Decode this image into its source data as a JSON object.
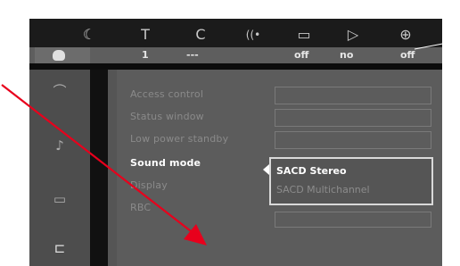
{
  "header": {
    "icons": [
      "settings-icon",
      "text-icon",
      "subtitle-c-icon",
      "audio-wave-icon",
      "screen-icon",
      "play-icon",
      "zoom-in-icon"
    ],
    "glyphs": [
      "☾",
      "T",
      "C",
      "((•",
      "▭",
      "▷",
      "⊕"
    ]
  },
  "value_bar": {
    "values": [
      "1",
      "---",
      "off",
      "no",
      "off"
    ]
  },
  "sidebar": {
    "icons": [
      "gauge-icon",
      "music-note-icon",
      "speech-bubble-icon",
      "remote-icon"
    ],
    "glyphs": [
      "⌒",
      "♪",
      "▭",
      "⊏"
    ]
  },
  "menu": {
    "rows": [
      {
        "label": "Access control"
      },
      {
        "label": "Status window"
      },
      {
        "label": "Low power standby"
      },
      {
        "label": "Sound mode"
      },
      {
        "label": "Display"
      },
      {
        "label": "RBC"
      }
    ],
    "active_index": 3
  },
  "dropdown": {
    "options": [
      "SACD Stereo",
      "SACD Multichannel"
    ],
    "selected": "SACD Stereo"
  },
  "colors": {
    "annotation_arrow": "#e8001c",
    "selected_text": "#ffffff",
    "dimmed_text": "#8a8a8a"
  }
}
